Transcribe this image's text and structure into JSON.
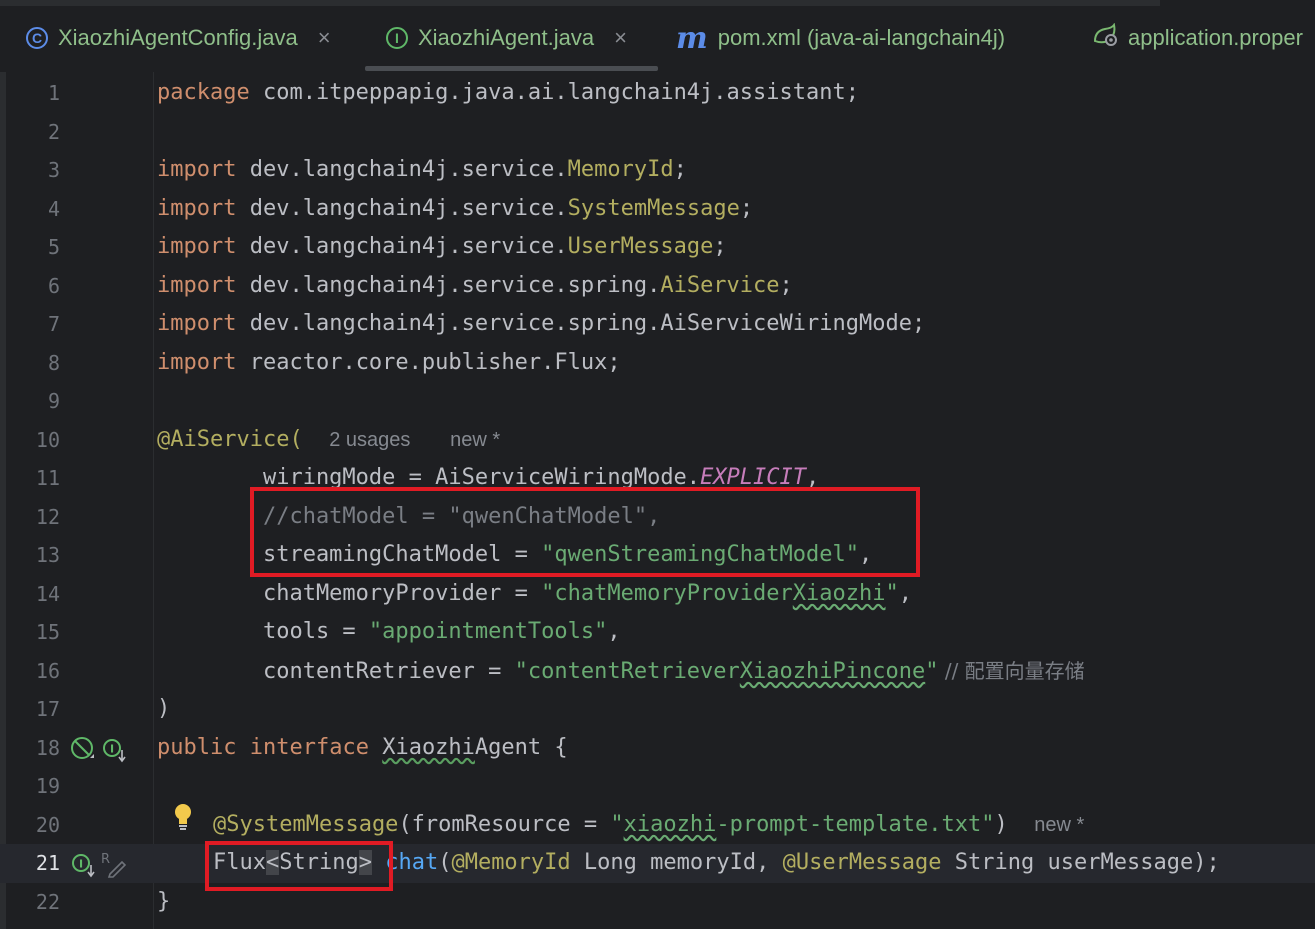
{
  "tabs": [
    {
      "label": "XiaozhiAgentConfig.java",
      "icon": "class-icon",
      "closable": true
    },
    {
      "label": "XiaozhiAgent.java",
      "icon": "interface-icon",
      "closable": true,
      "active": true
    },
    {
      "label": "pom.xml (java-ai-langchain4j)",
      "icon": "maven-icon",
      "closable": false
    },
    {
      "label": "application.proper",
      "icon": "spring-config-icon",
      "closable": false
    }
  ],
  "close_glyph": "×",
  "editor": {
    "line_numbers": [
      "1",
      "2",
      "3",
      "4",
      "5",
      "6",
      "7",
      "8",
      "9",
      "10",
      "11",
      "12",
      "13",
      "14",
      "15",
      "16",
      "17",
      "18",
      "19",
      "20",
      "21",
      "22"
    ],
    "current_line": 21,
    "line1": {
      "kw": "package",
      "rest": " com.itpeppapig.java.ai.langchain4j.assistant;"
    },
    "imports": [
      {
        "kw": "import",
        "pkg": " dev.langchain4j.service.",
        "cls": "MemoryId",
        "end": ";"
      },
      {
        "kw": "import",
        "pkg": " dev.langchain4j.service.",
        "cls": "SystemMessage",
        "end": ";"
      },
      {
        "kw": "import",
        "pkg": " dev.langchain4j.service.",
        "cls": "UserMessage",
        "end": ";"
      },
      {
        "kw": "import",
        "pkg": " dev.langchain4j.service.spring.",
        "cls": "AiService",
        "end": ";"
      },
      {
        "kw": "import",
        "pkg": " dev.langchain4j.service.spring.AiServiceWiringMode;",
        "cls": "",
        "end": ""
      },
      {
        "kw": "import",
        "pkg": " reactor.core.publisher.Flux;",
        "cls": "",
        "end": ""
      }
    ],
    "line10": {
      "ann": "@AiService(",
      "hint_usages": "2 usages",
      "hint_new": "new *"
    },
    "line11": {
      "a": "        wiringMode = AiServiceWiringMode.",
      "const": "EXPLICIT",
      "b": ","
    },
    "line12": {
      "cmt": "        //chatModel = \"qwenChatModel\","
    },
    "line13": {
      "a": "        streamingChatModel = ",
      "str": "\"qwenStreamingChatModel\"",
      "b": ","
    },
    "line14": {
      "a": "        chatMemoryProvider = ",
      "str1": "\"chatMemoryProvider",
      "str2": "Xiaozhi",
      "str3": "\"",
      "b": ","
    },
    "line15": {
      "a": "        tools = ",
      "str": "\"appointmentTools\"",
      "b": ","
    },
    "line16": {
      "a": "        contentRetriever = ",
      "str1": "\"contentRetriever",
      "str2": "XiaozhiPincone",
      "str3": "\"",
      "cmt": " // 配置向量存储"
    },
    "line17": {
      "text": ")"
    },
    "line18": {
      "kw1": "public",
      "kw2": "interface",
      "name1": "Xiaozhi",
      "name2": "Agent",
      "rest": " {"
    },
    "line20": {
      "ann": "@SystemMessage",
      "a": "(fromResource = ",
      "str1": "\"",
      "str2": "xiaozhi",
      "str3": "-prompt-template.txt\"",
      "b": ")",
      "hint_new": "new *"
    },
    "line21": {
      "t1": "Flux",
      "lt": "<",
      "t2": "String",
      "gt": ">",
      "sp": " ",
      "fn": "chat",
      "p1": "(",
      "ann1": "@MemoryId",
      "p2": " Long memoryId, ",
      "ann2": "@UserMessage",
      "p3": " String userMessage);"
    },
    "line22": {
      "text": "}"
    }
  },
  "colors": {
    "highlight_box": "#e01b24"
  }
}
